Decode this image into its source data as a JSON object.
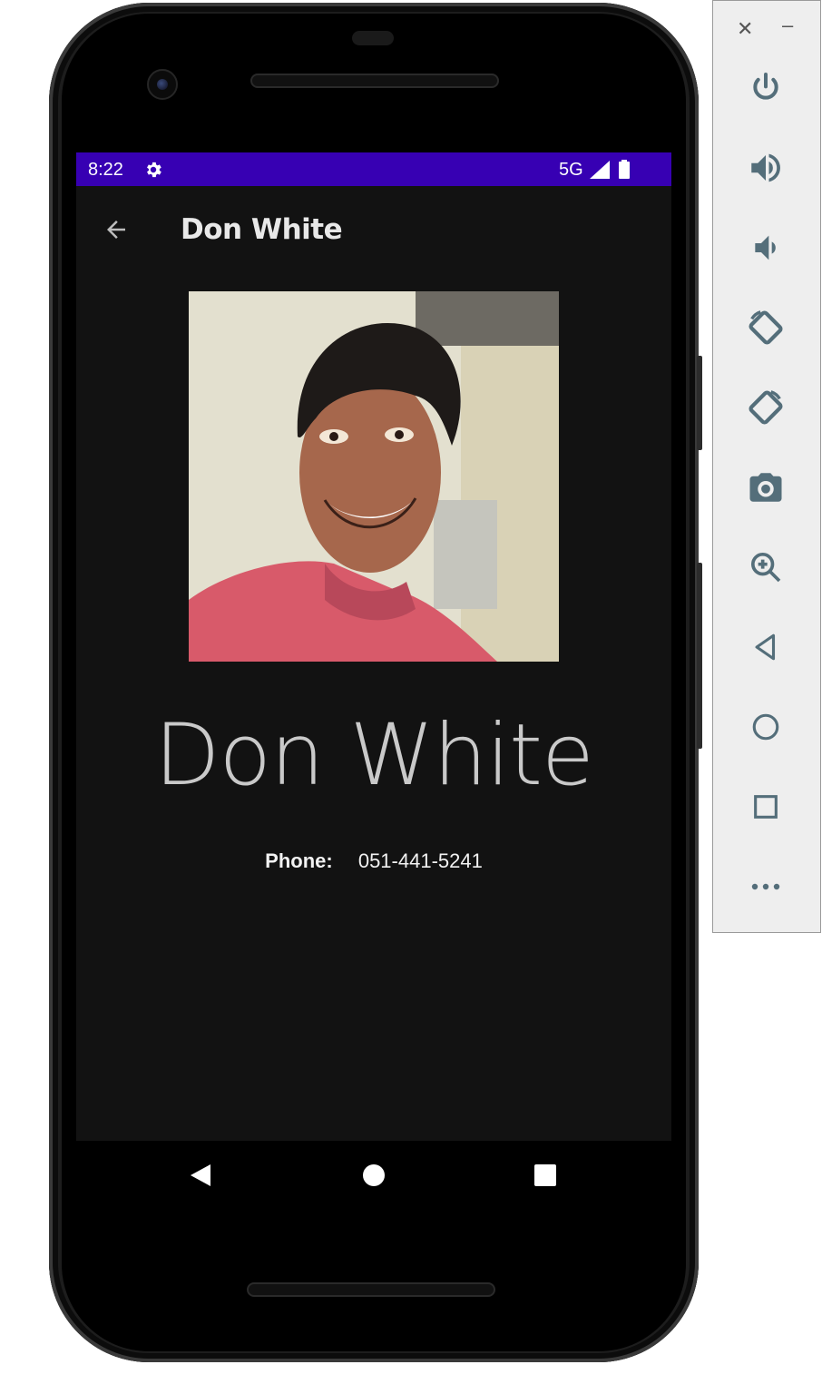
{
  "status_bar": {
    "time": "8:22",
    "network": "5G",
    "color": "#3700b3"
  },
  "app_bar": {
    "title": "Don White",
    "back_icon": "arrow-back-icon"
  },
  "contact": {
    "name": "Don White",
    "phone_label": "Phone:",
    "phone_number": "051-441-5241",
    "photo": "contact-photo"
  },
  "nav_bar": {
    "buttons": [
      "nav-back-icon",
      "nav-home-icon",
      "nav-recents-icon"
    ]
  },
  "emulator_panel": {
    "window_controls": [
      "close-icon",
      "minimize-icon"
    ],
    "buttons": [
      "power-icon",
      "volume-up-icon",
      "volume-down-icon",
      "rotate-left-icon",
      "rotate-right-icon",
      "screenshot-icon",
      "zoom-icon",
      "back-icon",
      "home-icon",
      "overview-icon",
      "more-icon"
    ]
  },
  "colors": {
    "screen_background": "#121212",
    "status_bar": "#3700b3",
    "text_primary": "#e8e8e8",
    "emulator_icon": "#546e7a"
  }
}
